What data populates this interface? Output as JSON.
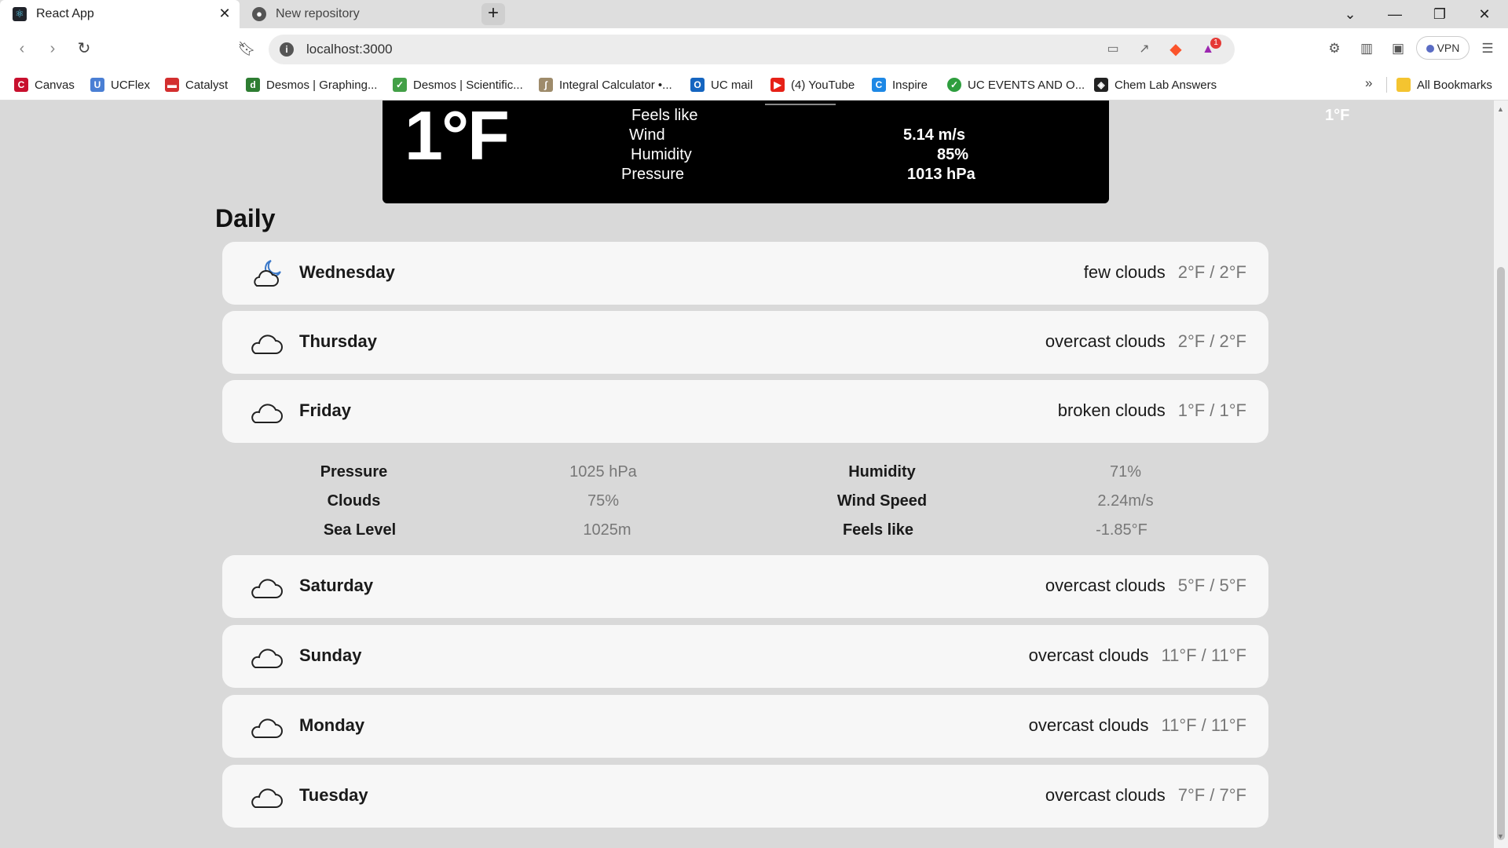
{
  "browser": {
    "tabs": [
      {
        "title": "React App",
        "icon": "react-icon"
      },
      {
        "title": "New repository",
        "icon": "github-icon"
      }
    ],
    "url": "localhost:3000",
    "vpn_label": "VPN",
    "brave_badge": "1",
    "bookmarks": [
      {
        "label": "Canvas",
        "color": "#c8102e"
      },
      {
        "label": "UCFlex",
        "color": "#4a7fd4"
      },
      {
        "label": "Catalyst",
        "color": "#d32f2f"
      },
      {
        "label": "Desmos | Graphing...",
        "color": "#2e7d32"
      },
      {
        "label": "Desmos | Scientific...",
        "color": "#43a047"
      },
      {
        "label": "Integral Calculator •...",
        "color": "#9e8b6b"
      },
      {
        "label": "UC mail",
        "color": "#1565c0"
      },
      {
        "label": "(4) YouTube",
        "color": "#e62117"
      },
      {
        "label": "Inspire",
        "color": "#1e88e5"
      },
      {
        "label": "UC EVENTS AND O...",
        "color": "#2e9e3e"
      },
      {
        "label": "Chem Lab Answers",
        "color": "#222222"
      }
    ],
    "all_bookmarks": "All Bookmarks"
  },
  "current": {
    "temp": "1°F",
    "rows": [
      {
        "label": "Feels like",
        "value": "1°F"
      },
      {
        "label": "Wind",
        "value": "5.14 m/s"
      },
      {
        "label": "Humidity",
        "value": "85%"
      },
      {
        "label": "Pressure",
        "value": "1013 hPa"
      }
    ]
  },
  "daily": {
    "title": "Daily",
    "days": [
      {
        "name": "Wednesday",
        "desc": "few clouds",
        "range": "2°F / 2°F",
        "icon": "partly-cloudy-night-icon"
      },
      {
        "name": "Thursday",
        "desc": "overcast clouds",
        "range": "2°F / 2°F",
        "icon": "cloud-icon"
      },
      {
        "name": "Friday",
        "desc": "broken clouds",
        "range": "1°F / 1°F",
        "icon": "cloud-icon"
      },
      {
        "name": "Saturday",
        "desc": "overcast clouds",
        "range": "5°F / 5°F",
        "icon": "cloud-icon"
      },
      {
        "name": "Sunday",
        "desc": "overcast clouds",
        "range": "11°F / 11°F",
        "icon": "cloud-icon"
      },
      {
        "name": "Monday",
        "desc": "overcast clouds",
        "range": "11°F / 11°F",
        "icon": "cloud-icon"
      },
      {
        "name": "Tuesday",
        "desc": "overcast clouds",
        "range": "7°F / 7°F",
        "icon": "cloud-icon"
      }
    ],
    "friday_details": {
      "pressure_label": "Pressure",
      "pressure": "1025 hPa",
      "clouds_label": "Clouds",
      "clouds": "75%",
      "sea_level_label": "Sea Level",
      "sea_level": "1025m",
      "humidity_label": "Humidity",
      "humidity": "71%",
      "wind_speed_label": "Wind Speed",
      "wind_speed": "2.24m/s",
      "feels_like_label": "Feels like",
      "feels_like": "-1.85°F"
    }
  }
}
